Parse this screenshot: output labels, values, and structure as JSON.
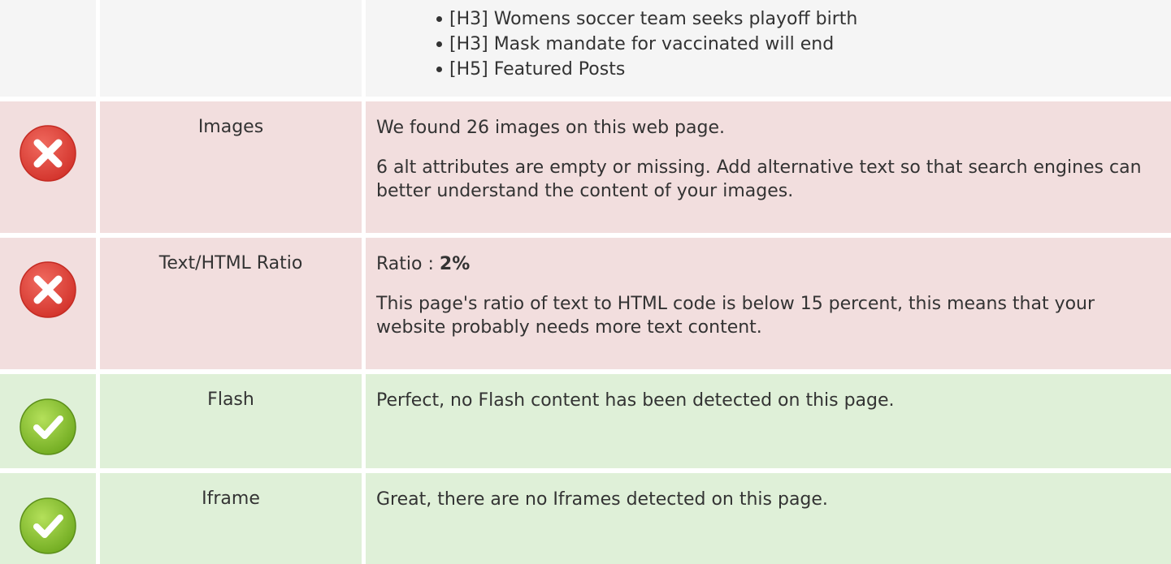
{
  "headings": {
    "items": [
      "[H3] Womens soccer team seeks playoff birth",
      "[H3] Mask mandate for vaccinated will end",
      "[H5] Featured Posts"
    ]
  },
  "images": {
    "label": "Images",
    "status": "error",
    "icon": "error-x-icon",
    "line1": "We found 26 images on this web page.",
    "line2": "6 alt attributes are empty or missing. Add alternative text so that search engines can better understand the content of your images."
  },
  "ratio": {
    "label": "Text/HTML Ratio",
    "status": "error",
    "icon": "error-x-icon",
    "prefix": "Ratio : ",
    "value": "2%",
    "line2": "This page's ratio of text to HTML code is below 15 percent, this means that your website probably needs more text content."
  },
  "flash": {
    "label": "Flash",
    "status": "ok",
    "icon": "check-icon",
    "line1": "Perfect, no Flash content has been detected on this page."
  },
  "iframe": {
    "label": "Iframe",
    "status": "ok",
    "icon": "check-icon",
    "line1": "Great, there are no Iframes detected on this page."
  },
  "colors": {
    "neutral_bg": "#f5f5f5",
    "error_bg": "#f2dede",
    "ok_bg": "#dff0d8",
    "error_icon": "#e2443b",
    "ok_icon": "#8cc63e"
  }
}
